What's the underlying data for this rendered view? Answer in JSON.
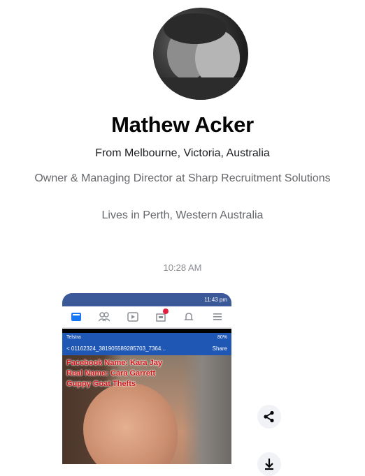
{
  "profile": {
    "name": "Mathew Acker",
    "from": "From Melbourne, Victoria, Australia",
    "work": "Owner & Managing Director at Sharp Recruitment Solutions",
    "lives": "Lives in Perth, Western Australia",
    "photo_icon": "profile-photo"
  },
  "conversation": {
    "timestamp": "10:28 AM"
  },
  "shared_image": {
    "phone_status": "11:43 pm",
    "inner_status_left": "Telstra",
    "inner_status_right": "80%",
    "file_name": "< 01162324_381905589285703_7364...",
    "file_action": "Share",
    "overlay_lines": [
      "Facebook Name: Kara Jay",
      "Real Name: Cara Garrett",
      "Guppy Goat Thefts"
    ]
  },
  "actions": {
    "share_icon": "share-icon",
    "download_icon": "download-icon"
  },
  "colors": {
    "facebook_blue": "#3b5998",
    "messenger_blue": "#1877f2",
    "secondary_text": "#65676b",
    "overlay_red": "#d41818"
  }
}
